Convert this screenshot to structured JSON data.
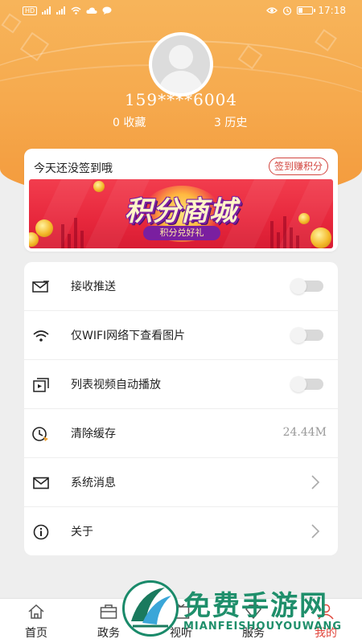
{
  "status_bar": {
    "time": "17:18",
    "network_badge": "HD",
    "icons": [
      "hd-icon",
      "signal-icon",
      "signal-icon",
      "wifi-icon",
      "cloud-icon",
      "chat-icon",
      "eye-icon",
      "alarm-icon",
      "battery-icon"
    ]
  },
  "profile": {
    "phone": "159****6004",
    "favorites_count": "0",
    "favorites_label": "收藏",
    "history_count": "3",
    "history_label": "历史"
  },
  "sign_in": {
    "message": "今天还没签到哦",
    "button_label": "签到赚积分"
  },
  "banner": {
    "title": "积分商城",
    "subtitle": "积分兑好礼"
  },
  "settings": [
    {
      "icon": "envelope-icon",
      "label": "接收推送",
      "control": "toggle",
      "on": false
    },
    {
      "icon": "wifi-icon",
      "label": "仅WIFI网络下查看图片",
      "control": "toggle",
      "on": false
    },
    {
      "icon": "video-icon",
      "label": "列表视频自动播放",
      "control": "toggle",
      "on": false
    },
    {
      "icon": "clock-icon",
      "label": "清除缓存",
      "control": "value",
      "value": "24.44M"
    },
    {
      "icon": "mail-icon",
      "label": "系统消息",
      "control": "chevron"
    },
    {
      "icon": "info-icon",
      "label": "关于",
      "control": "chevron"
    }
  ],
  "bottom_nav": [
    {
      "icon": "home-icon",
      "label": "首页"
    },
    {
      "icon": "briefcase-icon",
      "label": "政务"
    },
    {
      "icon": "tv-icon",
      "label": "视听"
    },
    {
      "icon": "service-icon",
      "label": "服务"
    },
    {
      "icon": "user-icon",
      "label": "我的"
    }
  ],
  "watermark": {
    "title": "免费手游网",
    "subtitle": "MIANFEISHOUYOUWANG"
  },
  "colors": {
    "header_orange": "#f6ab4f",
    "accent_red": "#d2453f",
    "active_tab": "#e0463c",
    "watermark_green": "#1f8f6b"
  }
}
